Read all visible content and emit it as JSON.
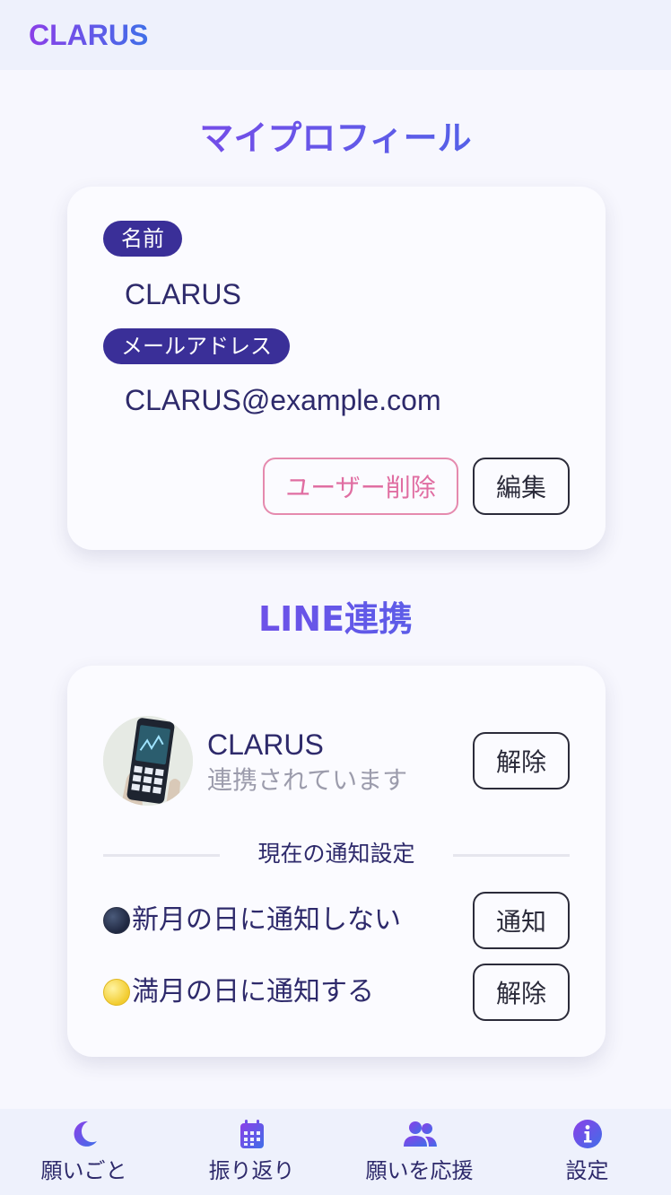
{
  "app": {
    "logo": "CLARUS"
  },
  "profile": {
    "title": "マイプロフィール",
    "name_label": "名前",
    "name_value": "CLARUS",
    "email_label": "メールアドレス",
    "email_value": "CLARUS@example.com",
    "delete_button": "ユーザー削除",
    "edit_button": "編集"
  },
  "line": {
    "title": "LINE連携",
    "account_name": "CLARUS",
    "status": "連携されています",
    "unlink_button": "解除",
    "divider_label": "現在の通知設定",
    "notifications": [
      {
        "text": "新月の日に通知しない",
        "button": "通知",
        "icon": "new-moon-icon"
      },
      {
        "text": "満月の日に通知する",
        "button": "解除",
        "icon": "full-moon-icon"
      }
    ]
  },
  "nav": {
    "items": [
      {
        "label": "願いごと",
        "icon": "moon-icon"
      },
      {
        "label": "振り返り",
        "icon": "calendar-icon"
      },
      {
        "label": "願いを応援",
        "icon": "users-icon"
      },
      {
        "label": "設定",
        "icon": "info-icon"
      }
    ]
  },
  "colors": {
    "accent_start": "#8b3fe8",
    "accent_end": "#3f6fe8",
    "pill": "#3a2f98",
    "danger": "#e06ea2",
    "background": "#f7f7fe",
    "bar": "#eef1fc"
  }
}
